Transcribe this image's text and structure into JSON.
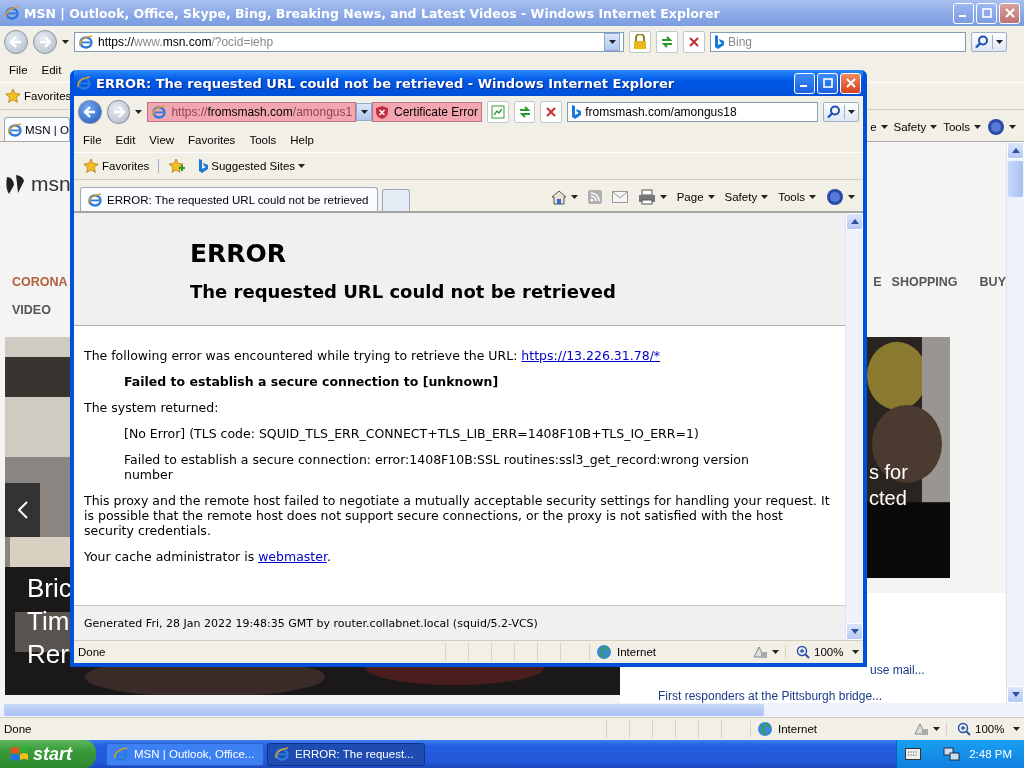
{
  "background_window": {
    "title": "MSN | Outlook, Office, Skype, Bing, Breaking News, and Latest Videos - Windows Internet Explorer",
    "address": [
      {
        "text": "https://",
        "dim": false
      },
      {
        "text": "www.",
        "dim": true
      },
      {
        "text": "msn.com",
        "dim": false
      },
      {
        "text": "/?ocid=iehp",
        "dim": true
      }
    ],
    "search_placeholder": "Bing",
    "menu": [
      "File",
      "Edit"
    ],
    "favorites_label": "Favorites",
    "tab": {
      "label": "MSN | O",
      "selected": true
    },
    "command_bar": [
      "e",
      "Safety",
      "Tools"
    ],
    "page": {
      "logo_text": "msn",
      "nav_left": [
        {
          "label": "CORONA",
          "color": "#b0603f"
        },
        {
          "label": "VIDEO",
          "color": "#555555"
        }
      ],
      "nav_right": [
        "E",
        "SHOPPING",
        "BUY"
      ],
      "left_photo": {
        "kind": "picture",
        "headline_lines": [
          "Bric",
          "Tim",
          "Rer"
        ]
      },
      "right_photo": {
        "kind": "picture",
        "headline_lines": [
          "s for",
          "cted"
        ]
      },
      "news_links": [
        "use mail...",
        "First responders at the Pittsburgh bridge..."
      ]
    },
    "status_bar": {
      "text": "Done",
      "zone": "Internet",
      "zoom": "100%"
    }
  },
  "popup_window": {
    "title": "ERROR: The requested URL could not be retrieved - Windows Internet Explorer",
    "address": [
      {
        "text": "https://",
        "dim": true
      },
      {
        "text": "fromsmash.com",
        "dim": false
      },
      {
        "text": "/amongus1",
        "dim": true
      }
    ],
    "certificate_error": "Certificate Error",
    "search_value": "fromsmash.com/amongus18",
    "menu": [
      "File",
      "Edit",
      "View",
      "Favorites",
      "Tools",
      "Help"
    ],
    "favorites_label": "Favorites",
    "suggested_sites": "Suggested Sites",
    "tabs": [
      {
        "label": "ERROR: The requested URL could not be retrieved",
        "selected": true
      }
    ],
    "command_bar": [
      "Page",
      "Safety",
      "Tools"
    ],
    "page": {
      "heading": "ERROR",
      "subheading": "The requested URL could not be retrieved",
      "body": [
        {
          "kind": "plain",
          "text": "The following error was encountered while trying to retrieve the URL: ",
          "link": "https://13.226.31.78/*"
        },
        {
          "kind": "detail_bold",
          "text": "Failed to establish a secure connection to [unknown]"
        },
        {
          "kind": "plain",
          "text": "The system returned:"
        },
        {
          "kind": "detail",
          "text": "[No Error] (TLS code: SQUID_TLS_ERR_CONNECT+TLS_LIB_ERR=1408F10B+TLS_IO_ERR=1)"
        },
        {
          "kind": "detail",
          "text": "Failed to establish a secure connection: error:1408F10B:SSL routines:ssl3_get_record:wrong version number"
        },
        {
          "kind": "plain",
          "text": "This proxy and the remote host failed to negotiate a mutually acceptable security settings for handling your request. It is possible that the remote host does not support secure connections, or the proxy is not satisfied with the host security credentials."
        },
        {
          "kind": "plain",
          "text": "Your cache administrator is ",
          "link": "webmaster",
          "tail": "."
        }
      ],
      "footer": "Generated Fri, 28 Jan 2022 19:48:35 GMT by router.collabnet.local (squid/5.2-VCS)"
    },
    "status_bar": {
      "text": "Done",
      "zone": "Internet",
      "zoom": "100%"
    }
  },
  "taskbar": {
    "start": "start",
    "tasks": [
      {
        "label": "MSN | Outlook, Office...",
        "selected": false
      },
      {
        "label": "ERROR: The request...",
        "selected": true
      }
    ],
    "clock": "2:48 PM"
  }
}
